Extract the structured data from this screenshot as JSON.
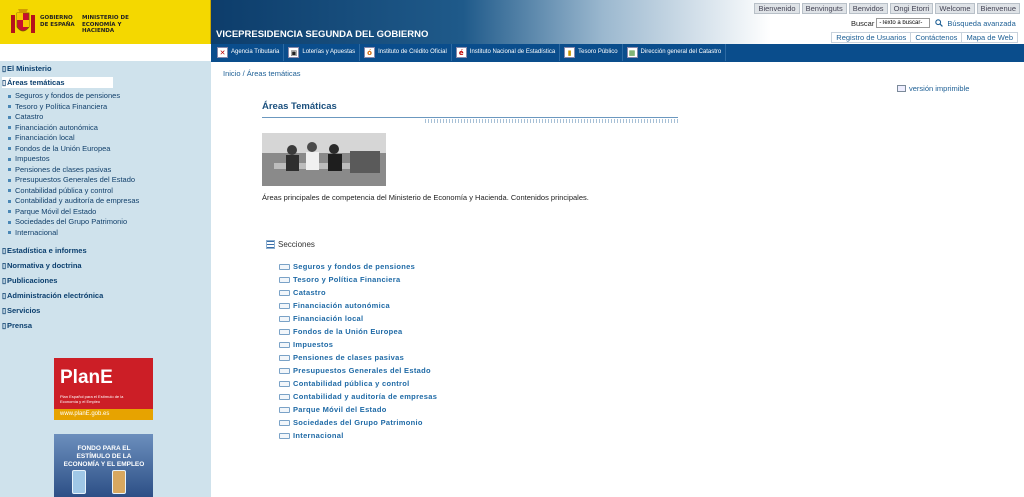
{
  "header": {
    "gobierno": "GOBIERNO DE ESPAÑA",
    "ministerio": "MINISTERIO DE ECONOMÍA Y HACIENDA",
    "title": "VICEPRESIDENCIA SEGUNDA DEL GOBIERNO",
    "languages": [
      "Bienvenido",
      "Benvinguts",
      "Benvidos",
      "Ongi Etorri",
      "Welcome",
      "Bienvenue"
    ],
    "search_label": "Buscar",
    "search_placeholder": "-Texto a buscar-",
    "advanced_search": "Búsqueda avanzada",
    "toplinks": [
      "Registro de Usuarios",
      "Contáctenos",
      "Mapa de Web"
    ]
  },
  "navbar": [
    {
      "label": "Agencia Tributaria",
      "icon": "agency-icon"
    },
    {
      "label": "Loterías y Apuestas",
      "icon": "lottery-icon"
    },
    {
      "label": "Instituto de Crédito Oficial",
      "icon": "ico-icon"
    },
    {
      "label": "Instituto Nacional de Estadística",
      "icon": "ine-icon"
    },
    {
      "label": "Tesoro Público",
      "icon": "treasury-icon"
    },
    {
      "label": "Dirección general del Catastro",
      "icon": "cadastre-icon"
    }
  ],
  "sidebar": {
    "sections": [
      "El Ministerio",
      "Áreas temáticas",
      "Estadística e informes",
      "Normativa y doctrina",
      "Publicaciones",
      "Administración electrónica",
      "Servicios",
      "Prensa"
    ],
    "subitems": [
      "Seguros y fondos de pensiones",
      "Tesoro y Política Financiera",
      "Catastro",
      "Financiación autonómica",
      "Financiación local",
      "Fondos de la Unión Europea",
      "Impuestos",
      "Pensiones de clases pasivas",
      "Presupuestos Generales del Estado",
      "Contabilidad pública y control",
      "Contabilidad y auditoría de empresas",
      "Parque Móvil del Estado",
      "Sociedades del Grupo Patrimonio",
      "Internacional"
    ],
    "plane": {
      "title": "PlanE",
      "subtitle": "Plan Español para el Estímulo de la Economía y el Empleo",
      "url": "www.planE.gob.es"
    },
    "fondo": "FONDO PARA EL ESTÍMULO DE LA ECONOMÍA Y EL EMPLEO"
  },
  "main": {
    "breadcrumb": "Inicio / Áreas temáticas",
    "print_version": "versión imprimible",
    "title": "Áreas Temáticas",
    "description": "Áreas principales de competencia del Ministerio de Economía y Hacienda. Contenidos principales.",
    "sections_title": "Secciones",
    "links": [
      "Seguros y fondos de pensiones",
      "Tesoro y Política Financiera",
      "Catastro",
      "Financiación autonómica",
      "Financiación local",
      "Fondos de la Unión Europea",
      "Impuestos",
      "Pensiones de clases pasivas",
      "Presupuestos Generales del Estado",
      "Contabilidad pública y control",
      "Contabilidad y auditoría de empresas",
      "Parque Móvil del Estado",
      "Sociedades del Grupo Patrimonio",
      "Internacional"
    ]
  },
  "colors": {
    "accent": "#0a4d8c",
    "sidebar": "#cfe2ec",
    "logo_band": "#f4d800"
  }
}
